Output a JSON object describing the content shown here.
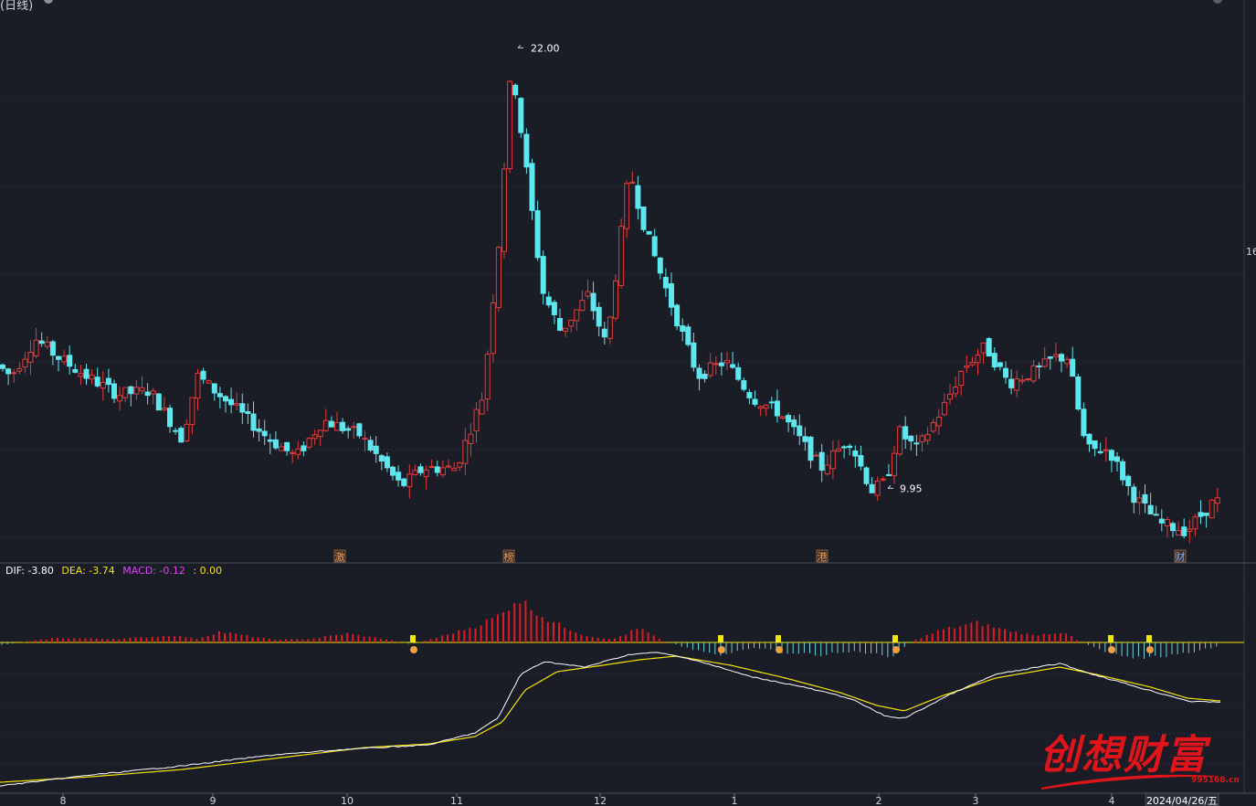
{
  "header": {
    "title": "(日线)"
  },
  "axis_right_label": "16",
  "macd": {
    "dif": "DIF: -3.80",
    "dea": "DEA: -3.74",
    "macd": "MACD: -0.12",
    "extra": ": 0.00",
    "colors": {
      "dif": "#ffffff",
      "dea": "#f5e600",
      "macd": "#e040fb",
      "extra": "#f5e600"
    }
  },
  "markers": [
    {
      "label": "激",
      "x": 372
    },
    {
      "label": "榜",
      "x": 557
    },
    {
      "label": "港",
      "x": 900
    },
    {
      "label": "财",
      "x": 1292
    }
  ],
  "x_ticks": [
    {
      "label": "8",
      "x": 69
    },
    {
      "label": "9",
      "x": 233
    },
    {
      "label": "10",
      "x": 380
    },
    {
      "label": "11",
      "x": 500
    },
    {
      "label": "12",
      "x": 657
    },
    {
      "label": "1",
      "x": 804
    },
    {
      "label": "2",
      "x": 962
    },
    {
      "label": "3",
      "x": 1068
    },
    {
      "label": "4",
      "x": 1217
    }
  ],
  "date_label": "2024/04/26/五",
  "watermark": {
    "text": "创想财富",
    "url": "995168.cn"
  },
  "chart_data": {
    "type": "candlestick",
    "title": "",
    "high_label": "22.00",
    "low_label": "9.95",
    "high_value": 22.0,
    "low_value": 9.95,
    "colors": {
      "up": "#e8393a",
      "down": "#5ce8ee",
      "dif": "#ffffff",
      "dea": "#f5e600"
    }
  }
}
